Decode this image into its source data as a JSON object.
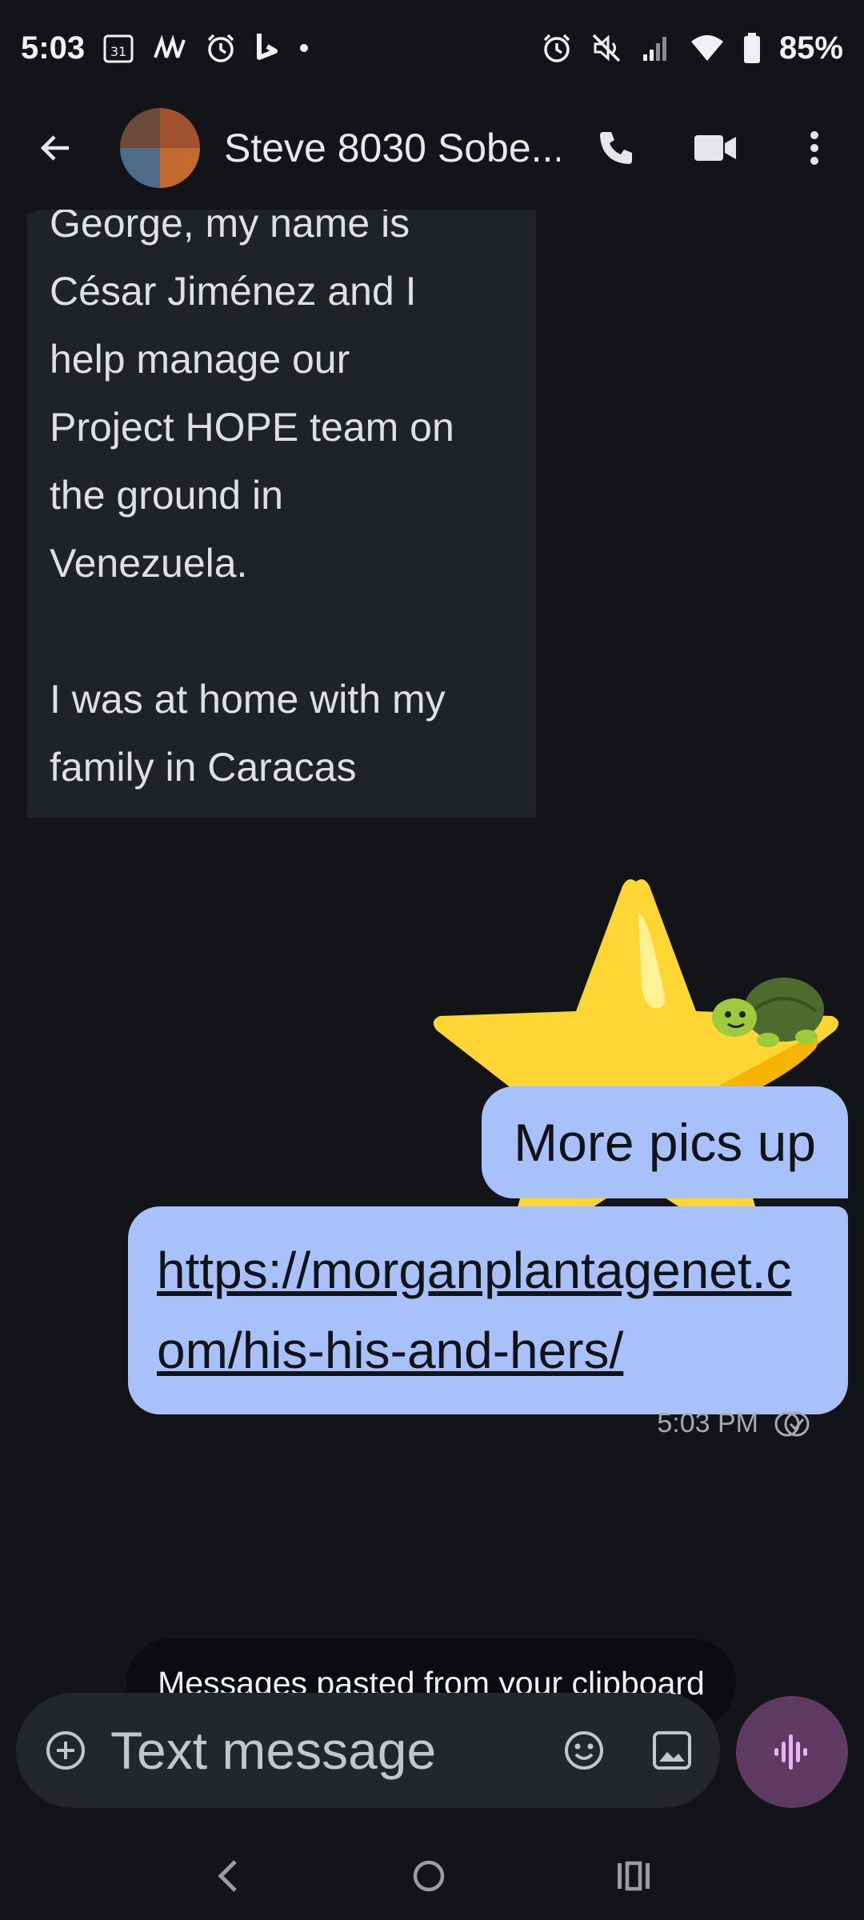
{
  "status_bar": {
    "time": "5:03",
    "calendar_badge": "31",
    "battery": "85%"
  },
  "header": {
    "contact_name": "Steve 8030 Sobe..."
  },
  "messages": {
    "incoming_text": "George, my name is\nCésar Jiménez and I\nhelp manage our\nProject HOPE team on\nthe ground in\nVenezuela.\n\nI was at home with my\nfamily in Caracas\nwhen the first",
    "outgoing_1": "More pics up",
    "outgoing_2_link": "https://morganplantagenet.com/his-his-and-hers/",
    "timestamp": "5:03 PM"
  },
  "toast": {
    "text": "Messages pasted from your clipboard"
  },
  "compose": {
    "placeholder": "Text message"
  },
  "colors": {
    "background": "#121418",
    "incoming_bubble": "#1f2227",
    "outgoing_bubble": "#a8c1fb",
    "voice_button": "#5f3a63",
    "voice_icon": "#e6b3f0"
  }
}
